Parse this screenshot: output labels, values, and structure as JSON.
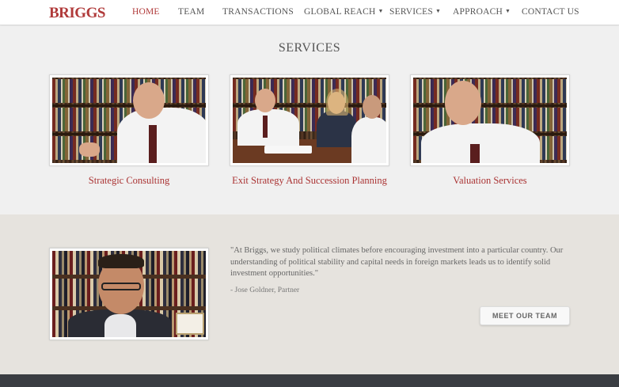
{
  "header": {
    "logo": "BRIGGS",
    "nav": [
      {
        "label": "HOME",
        "active": true,
        "has_dropdown": false
      },
      {
        "label": "TEAM",
        "active": false,
        "has_dropdown": false
      },
      {
        "label": "TRANSACTIONS",
        "active": false,
        "has_dropdown": false
      },
      {
        "label": "GLOBAL REACH",
        "active": false,
        "has_dropdown": true
      },
      {
        "label": "SERVICES",
        "active": false,
        "has_dropdown": true
      },
      {
        "label": "APPROACH",
        "active": false,
        "has_dropdown": true
      },
      {
        "label": "CONTACT US",
        "active": false,
        "has_dropdown": false
      }
    ]
  },
  "services": {
    "title": "SERVICES",
    "cards": [
      {
        "label": "Strategic Consulting"
      },
      {
        "label": "Exit Strategy And Succession Planning"
      },
      {
        "label": "Valuation Services"
      }
    ]
  },
  "team": {
    "quote": "\"At Briggs, we study political climates before encouraging investment into a particular country. Our understanding of political stability and capital needs in foreign markets leads us to identify solid investment opportunities.\"",
    "attribution": "- Jose Goldner, Partner",
    "button_label": "MEET OUR TEAM"
  },
  "colors": {
    "accent": "#b03a3a",
    "footer": "#3a3d42",
    "team_bg": "#e6e3de",
    "page_bg": "#f0f0f0"
  },
  "icons": {
    "dropdown": "chevron-down-icon"
  }
}
